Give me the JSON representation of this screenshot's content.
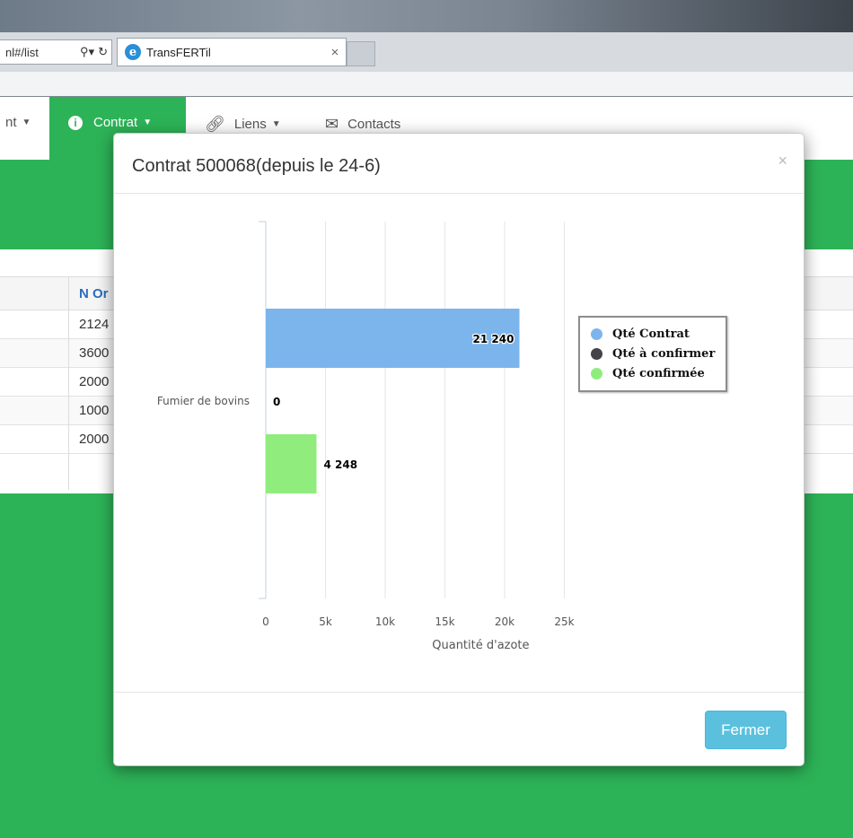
{
  "browser": {
    "address_fragment": "nl#/list",
    "tab_title": "TransFERTil",
    "tab_close": "×"
  },
  "nav": {
    "partial_item": "nt",
    "contrat": "Contrat",
    "liens": "Liens",
    "contacts": "Contacts",
    "active_color": "#2db357"
  },
  "table": {
    "header": "N Or",
    "rows": [
      "2124",
      "3600",
      "2000",
      "1000",
      "2000"
    ]
  },
  "modal": {
    "title": "Contrat 500068(depuis le 24-6)",
    "close": "×",
    "close_button": "Fermer"
  },
  "chart_data": {
    "type": "bar",
    "orientation": "horizontal",
    "categories": [
      "Fumier de bovins"
    ],
    "series": [
      {
        "name": "Qté Contrat",
        "values": [
          21240
        ],
        "color": "#7cb5ec",
        "label": "21 240"
      },
      {
        "name": "Qté à confirmer",
        "values": [
          0
        ],
        "color": "#434348",
        "label": "0"
      },
      {
        "name": "Qté confirmée",
        "values": [
          4248
        ],
        "color": "#90ed7d",
        "label": "4 248"
      }
    ],
    "xlabel": "Quantité d'azote",
    "xticks": [
      "0",
      "5k",
      "10k",
      "15k",
      "20k",
      "25k"
    ],
    "xlim": [
      0,
      25000
    ],
    "grid": true,
    "legend_position": "right"
  }
}
